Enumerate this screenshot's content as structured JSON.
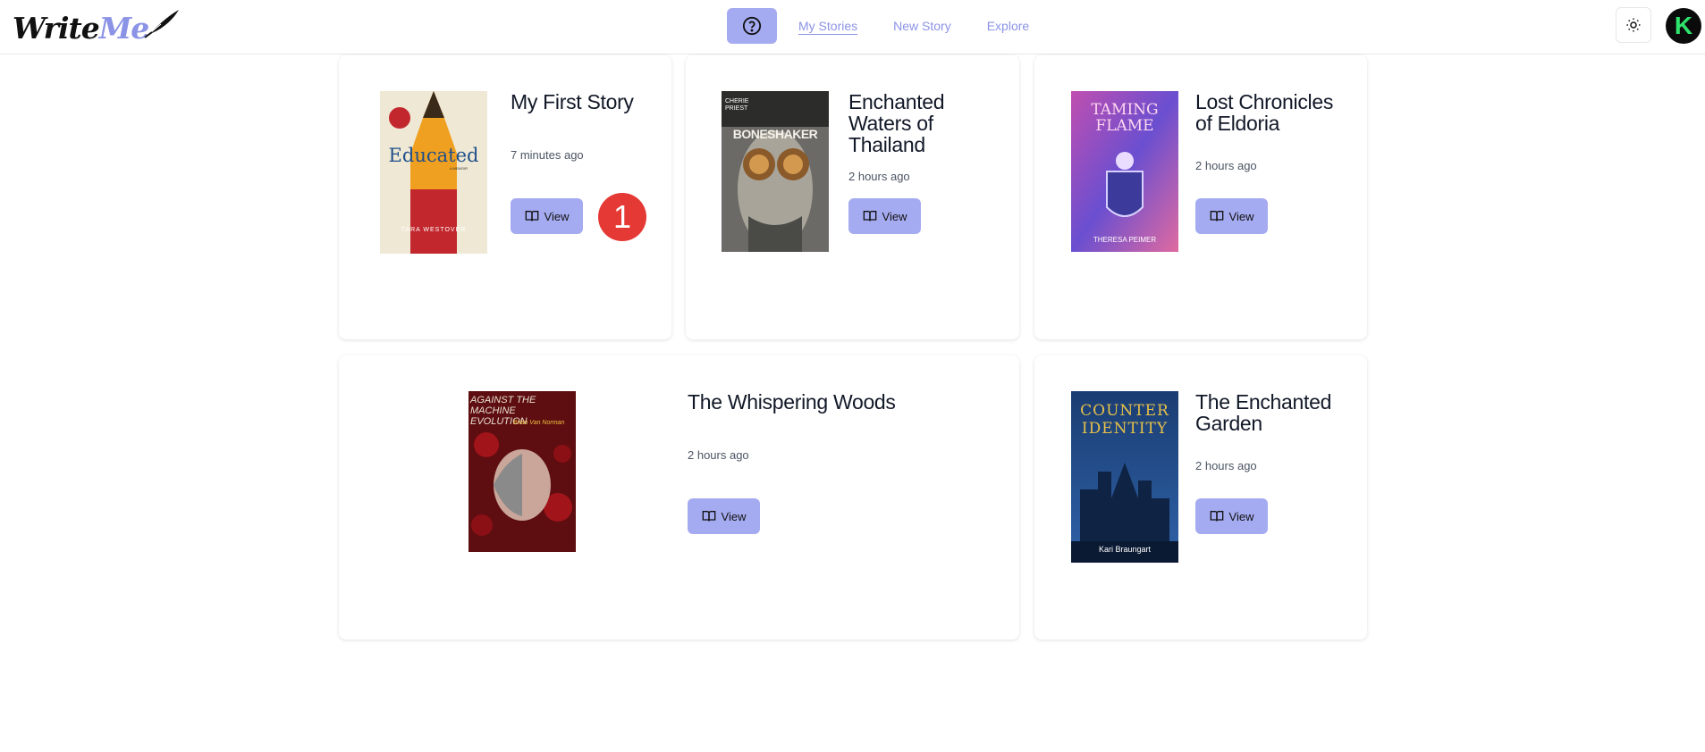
{
  "header": {
    "logo": {
      "write": "Write",
      "me": "Me"
    },
    "nav": [
      {
        "label": "My Stories",
        "active": true
      },
      {
        "label": "New Story",
        "active": false
      },
      {
        "label": "Explore",
        "active": false
      }
    ],
    "avatar_initial": "K"
  },
  "stories": [
    {
      "title": "My First Story",
      "time": "7 minutes ago",
      "view_label": "View",
      "cover": {
        "title": "Educated",
        "author": "TARA WESTOVER",
        "tag": "A MEMOIR"
      }
    },
    {
      "title": "Enchanted Waters of Thailand",
      "time": "2 hours ago",
      "view_label": "View",
      "cover": {
        "title": "BONESHAKER",
        "author": "CHERIE PRIEST"
      }
    },
    {
      "title": "Lost Chronicles of Eldoria",
      "time": "2 hours ago",
      "view_label": "View",
      "cover": {
        "title": "TAMING FLAME",
        "author": "THERESA PEIMER"
      }
    },
    {
      "title": "The Whispering Woods",
      "time": "2 hours ago",
      "view_label": "View",
      "cover": {
        "title": "AGAINST THE MACHINE EVOLUTION",
        "author": "Brian Van Norman"
      }
    },
    {
      "title": "The Enchanted Garden",
      "time": "2 hours ago",
      "view_label": "View",
      "cover": {
        "title": "COUNTER IDENTITY",
        "author": "Kari Braungart"
      }
    }
  ],
  "annotation_badge": "1",
  "colors": {
    "accent": "#a5abf0",
    "link": "#8b93e6",
    "badge": "#e53935"
  }
}
